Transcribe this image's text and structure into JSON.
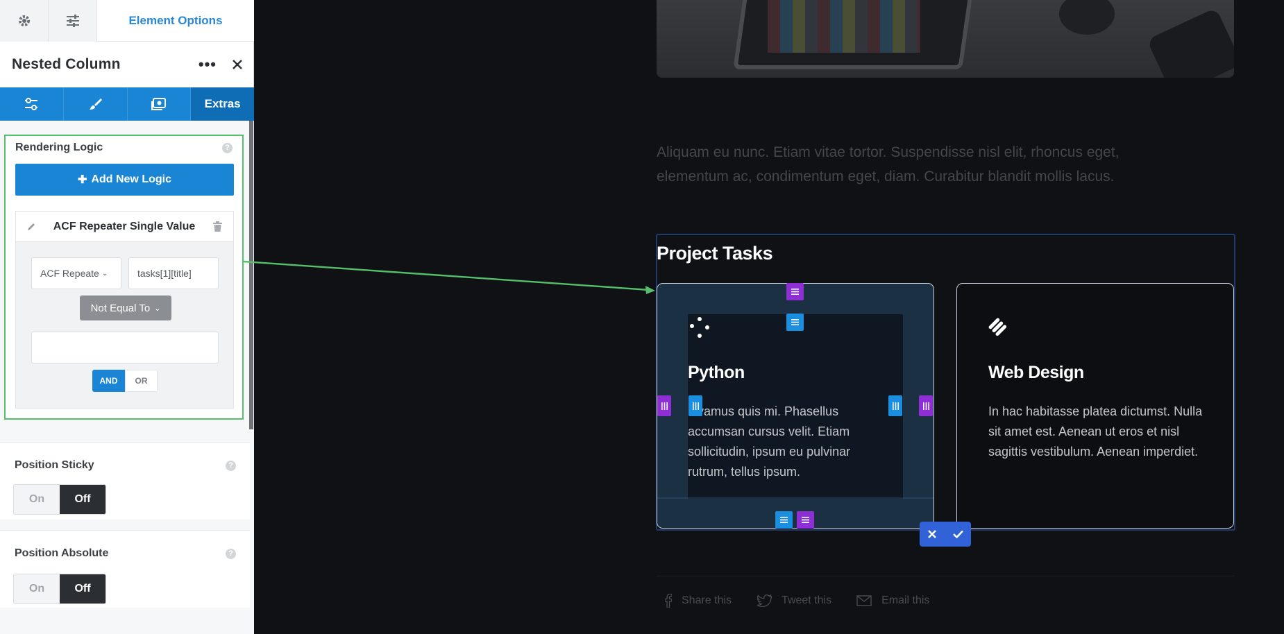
{
  "panel": {
    "top_tabs": {
      "active_label": "Element Options"
    },
    "title": "Nested Column",
    "section_tabs": {
      "active_label": "Extras"
    },
    "rendering_logic": {
      "label": "Rendering Logic",
      "help": "?",
      "add_button": "Add New Logic",
      "card_title": "ACF Repeater Single Value",
      "source_select": "ACF Repeate",
      "field_value": "tasks[1][title]",
      "operator": "Not Equal To",
      "compare_value": "",
      "and_label": "AND",
      "or_label": "OR"
    },
    "position_sticky": {
      "label": "Position Sticky",
      "help": "?",
      "on": "On",
      "off": "Off",
      "selected": "Off"
    },
    "position_absolute": {
      "label": "Position Absolute",
      "help": "?",
      "on": "On",
      "off": "Off",
      "selected": "Off"
    }
  },
  "canvas": {
    "lorem": "Aliquam eu nunc. Etiam vitae tortor. Suspendisse nisl elit, rhoncus eget, elementum ac, condimentum eget, diam. Curabitur blandit mollis lacus.",
    "section_title": "Project Tasks",
    "cards": [
      {
        "title": "Python",
        "text": "vamus quis mi. Phasellus accumsan cursus velit. Etiam sollicitudin, ipsum eu pulvinar rutrum, tellus ipsum."
      },
      {
        "title": "Web Design",
        "text": "In hac habitasse platea dictumst. Nulla sit amet est. Aenean ut eros et nisl sagittis vestibulum. Aenean imperdiet."
      }
    ],
    "share": [
      {
        "label": "Share this",
        "icon": "facebook-icon"
      },
      {
        "label": "Tweet this",
        "icon": "twitter-icon"
      },
      {
        "label": "Email this",
        "icon": "email-icon"
      }
    ]
  },
  "colors": {
    "accent": "#1a85d5",
    "highlight_green": "#55c06b",
    "handle_purple": "#8e2fd6",
    "handle_blue": "#1a8fe0"
  }
}
